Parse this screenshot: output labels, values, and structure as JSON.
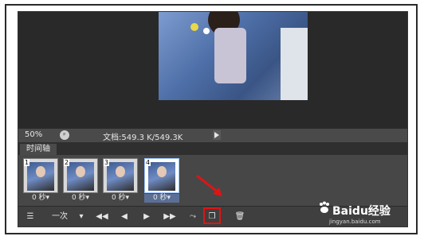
{
  "status_bar": {
    "zoom": "50%",
    "doc_info": "文档:549.3 K/549.3K"
  },
  "timeline_panel": {
    "tab_label": "时间轴",
    "frames": [
      {
        "number": "1",
        "delay": "0 秒▾"
      },
      {
        "number": "2",
        "delay": "0 秒▾"
      },
      {
        "number": "3",
        "delay": "0 秒▾"
      },
      {
        "number": "4",
        "delay": "0 秒▾",
        "selected": true
      }
    ],
    "controls": {
      "loop_label": "一次",
      "loop_dropdown": "▾",
      "first_frame": "◀◀",
      "prev_frame": "◀",
      "play": "▶",
      "next_frame": "▶▶",
      "tween": "⤳",
      "duplicate": "❐",
      "delete": "🗑"
    }
  },
  "watermark": {
    "brand": "Baidu经验",
    "url": "jingyan.baidu.com"
  },
  "colors": {
    "highlight": "#e01414",
    "selected_frame": "#9ec3ff"
  }
}
